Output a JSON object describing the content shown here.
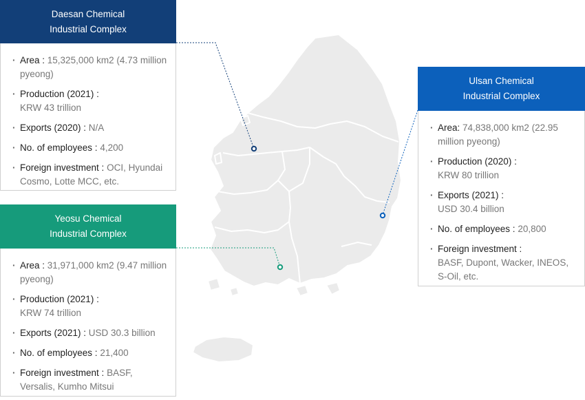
{
  "colors": {
    "daesan": "#123f78",
    "yeosu": "#169b7b",
    "ulsan": "#0c60bb",
    "land": "#ebebeb",
    "border": "#ffffff"
  },
  "daesan": {
    "title_line1": "Daesan Chemical",
    "title_line2": "Industrial Complex",
    "items": [
      {
        "label": "Area : ",
        "value": "15,325,000 km2 (4.73 million pyeong)"
      },
      {
        "label": "Production (2021) : ",
        "value": "KRW 43 trillion"
      },
      {
        "label": "Exports (2020) : ",
        "value": "N/A"
      },
      {
        "label": "No. of employees : ",
        "value": "4,200"
      },
      {
        "label": "Foreign investment : ",
        "value": "OCI, Hyundai Cosmo, Lotte MCC, etc."
      }
    ]
  },
  "yeosu": {
    "title_line1": "Yeosu Chemical",
    "title_line2": "Industrial Complex",
    "items": [
      {
        "label": "Area : ",
        "value": "31,971,000 km2 (9.47 million pyeong)"
      },
      {
        "label": "Production (2021) : ",
        "value": "KRW 74 trillion"
      },
      {
        "label": "Exports (2021) : ",
        "value": "USD 30.3 billion"
      },
      {
        "label": "No. of employees : ",
        "value": "21,400"
      },
      {
        "label": "Foreign investment : ",
        "value": "BASF, Versalis, Kumho Mitsui"
      }
    ]
  },
  "ulsan": {
    "title_line1": "Ulsan Chemical",
    "title_line2": "Industrial Complex",
    "items": [
      {
        "label": "Area: ",
        "value": "74,838,000 km2 (22.95 million pyeong)"
      },
      {
        "label": "Production (2020) : ",
        "value": "KRW 80 trillion"
      },
      {
        "label": "Exports (2021) : ",
        "value": "USD 30.4 billion"
      },
      {
        "label": "No. of employees : ",
        "value": "20,800"
      },
      {
        "label": "Foreign investment : ",
        "value": "BASF, Dupont, Wacker, INEOS, S-Oil, etc."
      }
    ]
  }
}
